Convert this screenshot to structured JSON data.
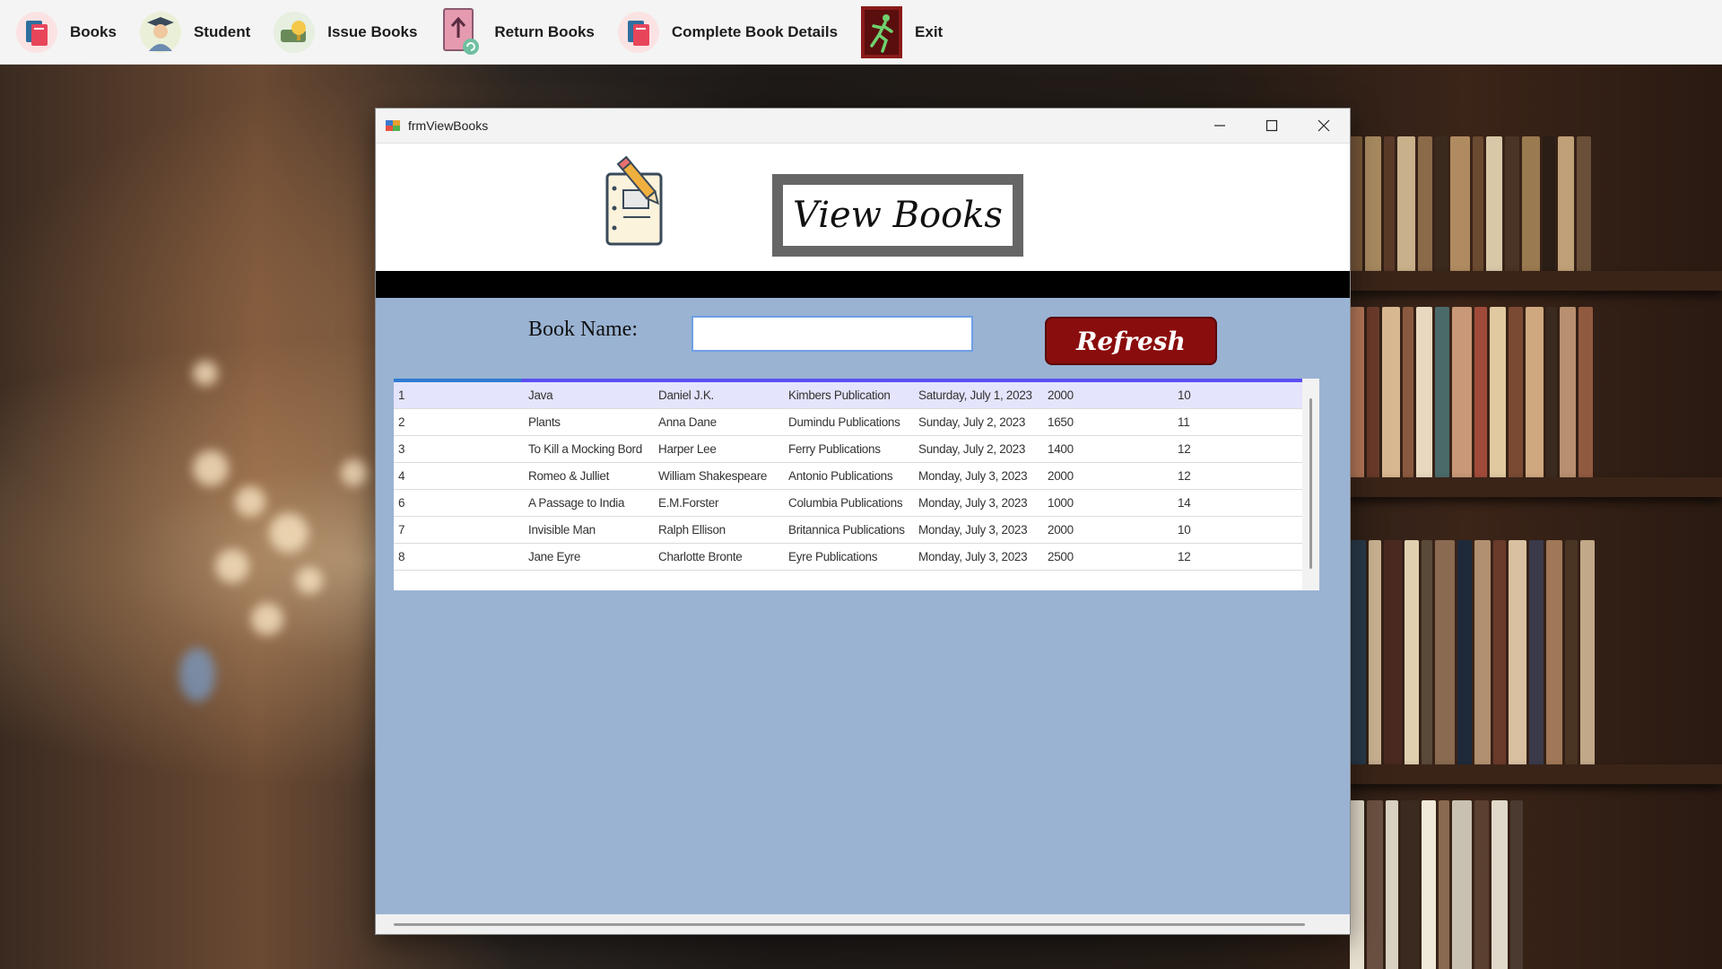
{
  "toolbar": {
    "items": [
      {
        "label": "Books",
        "icon": "books-icon"
      },
      {
        "label": "Student",
        "icon": "student-icon"
      },
      {
        "label": "Issue Books",
        "icon": "issue-books-icon"
      },
      {
        "label": "Return Books",
        "icon": "return-books-icon"
      },
      {
        "label": "Complete Book Details",
        "icon": "book-details-icon"
      },
      {
        "label": "Exit",
        "icon": "exit-icon"
      }
    ]
  },
  "window": {
    "title": "frmViewBooks",
    "heading": "View Books",
    "search": {
      "label": "Book Name:",
      "value": "",
      "placeholder": ""
    },
    "refresh_label": "Refresh"
  },
  "books": [
    {
      "id": "1",
      "name": "Java",
      "author": "Daniel J.K.",
      "publication": "Kimbers Publication",
      "date": "Saturday, July 1, 2023",
      "price": "2000",
      "quantity": "10"
    },
    {
      "id": "2",
      "name": "Plants",
      "author": "Anna Dane",
      "publication": "Dumindu Publications",
      "date": "Sunday, July 2, 2023",
      "price": "1650",
      "quantity": "11"
    },
    {
      "id": "3",
      "name": "To Kill a Mocking Bord",
      "author": "Harper Lee",
      "publication": "Ferry Publications",
      "date": "Sunday, July 2, 2023",
      "price": "1400",
      "quantity": "12"
    },
    {
      "id": "4",
      "name": "Romeo & Julliet",
      "author": "William Shakespeare",
      "publication": "Antonio Publications",
      "date": "Monday, July 3, 2023",
      "price": "2000",
      "quantity": "12"
    },
    {
      "id": "6",
      "name": "A Passage to India",
      "author": "E.M.Forster",
      "publication": "Columbia Publications",
      "date": "Monday, July 3, 2023",
      "price": "1000",
      "quantity": "14"
    },
    {
      "id": "7",
      "name": "Invisible Man",
      "author": "Ralph Ellison",
      "publication": "Britannica Publications",
      "date": "Monday, July 3, 2023",
      "price": "2000",
      "quantity": "10"
    },
    {
      "id": "8",
      "name": "Jane Eyre",
      "author": "Charlotte Bronte",
      "publication": "Eyre Publications",
      "date": "Monday, July 3, 2023",
      "price": "2500",
      "quantity": "12"
    }
  ],
  "colors": {
    "window_bg": "#9ab3d3",
    "refresh_bg": "#8a0d0d",
    "selected_row": "#e4e4fc"
  }
}
